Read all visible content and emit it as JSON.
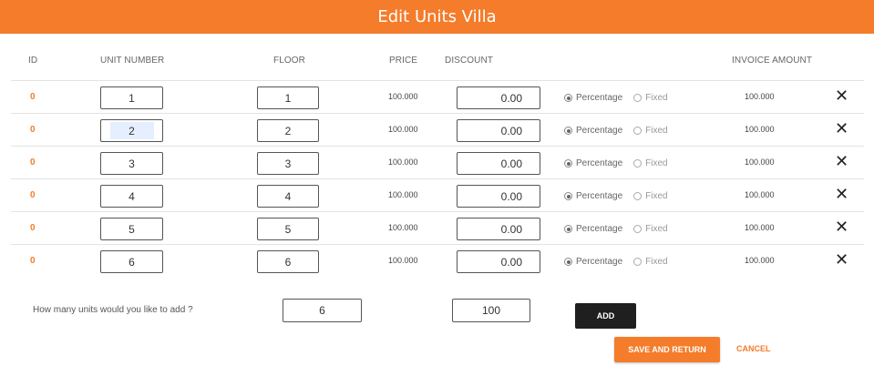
{
  "header": {
    "title": "Edit Units Villa"
  },
  "columns": {
    "id": "ID",
    "unit_number": "UNIT NUMBER",
    "floor": "FLOOR",
    "price": "PRICE",
    "discount": "DISCOUNT",
    "invoice_amount": "INVOICE AMOUNT"
  },
  "rows": [
    {
      "id": "0",
      "unit": "1",
      "floor": "1",
      "price": "100.000",
      "discount": "0.00",
      "opt_percentage": "Percentage",
      "opt_fixed": "Fixed",
      "selected": "Percentage",
      "invoice": "100.000",
      "remove": "✕"
    },
    {
      "id": "0",
      "unit": "2",
      "floor": "2",
      "price": "100.000",
      "discount": "0.00",
      "opt_percentage": "Percentage",
      "opt_fixed": "Fixed",
      "selected": "Percentage",
      "invoice": "100.000",
      "remove": "✕"
    },
    {
      "id": "0",
      "unit": "3",
      "floor": "3",
      "price": "100.000",
      "discount": "0.00",
      "opt_percentage": "Percentage",
      "opt_fixed": "Fixed",
      "selected": "Percentage",
      "invoice": "100.000",
      "remove": "✕"
    },
    {
      "id": "0",
      "unit": "4",
      "floor": "4",
      "price": "100.000",
      "discount": "0.00",
      "opt_percentage": "Percentage",
      "opt_fixed": "Fixed",
      "selected": "Percentage",
      "invoice": "100.000",
      "remove": "✕"
    },
    {
      "id": "0",
      "unit": "5",
      "floor": "5",
      "price": "100.000",
      "discount": "0.00",
      "opt_percentage": "Percentage",
      "opt_fixed": "Fixed",
      "selected": "Percentage",
      "invoice": "100.000",
      "remove": "✕"
    },
    {
      "id": "0",
      "unit": "6",
      "floor": "6",
      "price": "100.000",
      "discount": "0.00",
      "opt_percentage": "Percentage",
      "opt_fixed": "Fixed",
      "selected": "Percentage",
      "invoice": "100.000",
      "remove": "✕"
    }
  ],
  "add_section": {
    "label": "How many units would you like to add ?",
    "quantity": "6",
    "price": "100",
    "add_button": "ADD"
  },
  "footer": {
    "save_button": "SAVE AND RETURN",
    "cancel_button": "CANCEL"
  },
  "colors": {
    "accent": "#f47c2a",
    "dark_button": "#1f1f1f",
    "focus_highlight": "#e6efff"
  },
  "icons": {
    "remove": "close-icon",
    "radio": "radio-icon"
  }
}
